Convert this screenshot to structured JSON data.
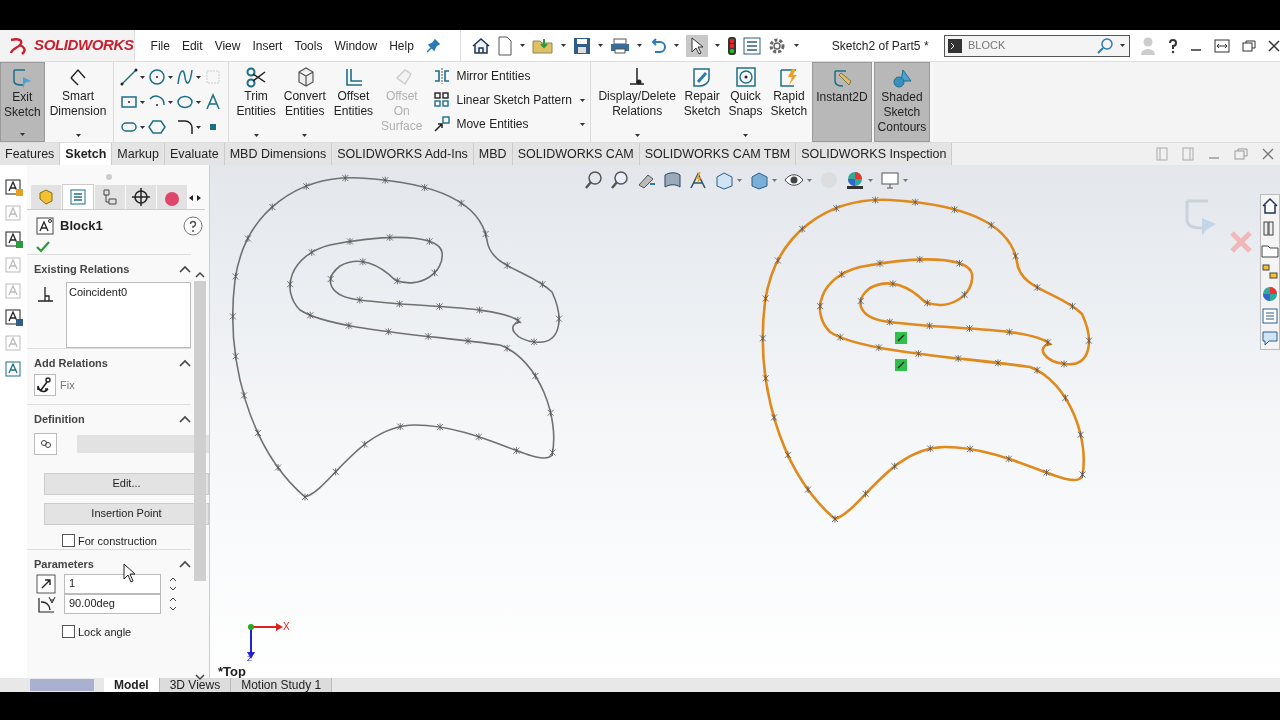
{
  "logo": "SOLIDWORKS",
  "menu": [
    "File",
    "Edit",
    "View",
    "Insert",
    "Tools",
    "Window",
    "Help"
  ],
  "document_title": "Sketch2 of Part5 *",
  "search": {
    "value": "BLOCK"
  },
  "ribbon": {
    "left_buttons": [
      {
        "label": "Exit Sketch",
        "selected": true,
        "dropdown": true
      },
      {
        "label": "Smart Dimension",
        "selected": false,
        "dropdown": true
      }
    ],
    "edit_buttons": [
      {
        "label": "Trim Entities",
        "disabled": false,
        "dropdown": true
      },
      {
        "label": "Convert Entities",
        "disabled": false,
        "dropdown": true
      },
      {
        "label": "Offset Entities",
        "disabled": false,
        "dropdown": false
      },
      {
        "label": "Offset On Surface",
        "disabled": true,
        "dropdown": false
      }
    ],
    "small_buttons": [
      {
        "label": "Mirror Entities",
        "dropdown": false
      },
      {
        "label": "Linear Sketch Pattern",
        "dropdown": true
      },
      {
        "label": "Move Entities",
        "dropdown": true
      }
    ],
    "right_buttons": [
      {
        "label": "Display/Delete Relations",
        "selected": false,
        "dropdown": true
      },
      {
        "label": "Repair Sketch",
        "selected": false,
        "dropdown": false
      },
      {
        "label": "Quick Snaps",
        "selected": false,
        "dropdown": true
      },
      {
        "label": "Rapid Sketch",
        "selected": false,
        "dropdown": false
      },
      {
        "label": "Instant2D",
        "selected": true,
        "dropdown": false
      },
      {
        "label": "Shaded Sketch Contours",
        "selected": true,
        "dropdown": false
      }
    ]
  },
  "command_tabs": [
    {
      "label": "Features",
      "selected": false
    },
    {
      "label": "Sketch",
      "selected": true
    },
    {
      "label": "Markup",
      "selected": false
    },
    {
      "label": "Evaluate",
      "selected": false
    },
    {
      "label": "MBD Dimensions",
      "selected": false
    },
    {
      "label": "SOLIDWORKS Add-Ins",
      "selected": false
    },
    {
      "label": "MBD",
      "selected": false
    },
    {
      "label": "SOLIDWORKS CAM",
      "selected": false
    },
    {
      "label": "SOLIDWORKS CAM TBM",
      "selected": false
    },
    {
      "label": "SOLIDWORKS Inspection",
      "selected": false
    }
  ],
  "property_manager": {
    "title": "Block1",
    "existing_relations": {
      "heading": "Existing Relations",
      "items": [
        "Coincident0"
      ]
    },
    "add_relations": {
      "heading": "Add Relations",
      "items": [
        "Fix"
      ]
    },
    "definition": {
      "heading": "Definition",
      "buttons": [
        "Edit...",
        "Insertion Point"
      ],
      "for_construction": {
        "label": "For construction",
        "checked": false
      }
    },
    "parameters": {
      "heading": "Parameters",
      "scale": "1",
      "angle": "90.00deg",
      "lock_angle": {
        "label": "Lock angle",
        "checked": false
      }
    }
  },
  "view": {
    "orientation": "*Top",
    "axis_x": "X",
    "axis_z": "Z"
  },
  "sketches": [
    {
      "selected": false
    },
    {
      "selected": true
    }
  ],
  "bottom_tabs": [
    {
      "label": "Model",
      "selected": true
    },
    {
      "label": "3D Views",
      "selected": false
    },
    {
      "label": "Motion Study 1",
      "selected": false
    }
  ]
}
